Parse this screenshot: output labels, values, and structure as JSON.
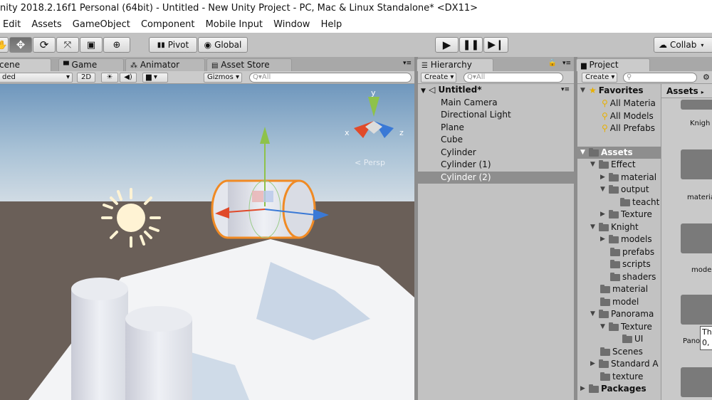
{
  "window": {
    "title": "nity 2018.2.16f1 Personal (64bit) - Untitled - New Unity Project - PC, Mac & Linux Standalone* <DX11>"
  },
  "menu": [
    "Edit",
    "Assets",
    "GameObject",
    "Component",
    "Mobile Input",
    "Window",
    "Help"
  ],
  "toolbar": {
    "pivot_label": "Pivot",
    "global_label": "Global",
    "collab_label": "Collab",
    "tools": [
      "hand-tool",
      "move-tool",
      "rotate-tool",
      "scale-tool",
      "rect-tool",
      "transform-tool"
    ]
  },
  "scene_tabs": {
    "scene": "cene",
    "game": "Game",
    "animator": "Animator",
    "asset_store": "Asset Store"
  },
  "scene_toolbar": {
    "shading": "ded",
    "mode_2d": "2D",
    "gizmos": "Gizmos",
    "search_placeholder": "Q▾All"
  },
  "gizmo": {
    "y": "y",
    "x": "x",
    "z": "z",
    "persp": "< Persp"
  },
  "hierarchy": {
    "tab": "Hierarchy",
    "create": "Create",
    "search_placeholder": "Q▾All",
    "scene_name": "Untitled*",
    "items": [
      "Main Camera",
      "Directional Light",
      "Plane",
      "Cube",
      "Cylinder",
      "Cylinder (1)",
      "Cylinder (2)"
    ],
    "selected_index": 6
  },
  "project": {
    "tab": "Project",
    "create": "Create",
    "favorites_label": "Favorites",
    "favorites": [
      "All Materia",
      "All Models",
      "All Prefabs"
    ],
    "assets_label": "Assets",
    "tree": [
      {
        "label": "Effect",
        "level": 1,
        "expanded": true
      },
      {
        "label": "material",
        "level": 2,
        "expanded": false
      },
      {
        "label": "output",
        "level": 2,
        "expanded": true
      },
      {
        "label": "teacht",
        "level": 3,
        "expanded": null
      },
      {
        "label": "Texture",
        "level": 2,
        "expanded": false
      },
      {
        "label": "Knight",
        "level": 1,
        "expanded": true
      },
      {
        "label": "models",
        "level": 2,
        "expanded": false
      },
      {
        "label": "prefabs",
        "level": 2,
        "expanded": null
      },
      {
        "label": "scripts",
        "level": 2,
        "expanded": null
      },
      {
        "label": "shaders",
        "level": 2,
        "expanded": null
      },
      {
        "label": "material",
        "level": 1,
        "expanded": null
      },
      {
        "label": "model",
        "level": 1,
        "expanded": null
      },
      {
        "label": "Panorama",
        "level": 1,
        "expanded": true
      },
      {
        "label": "Texture",
        "level": 2,
        "expanded": true
      },
      {
        "label": "UI",
        "level": 3,
        "expanded": null
      },
      {
        "label": "Scenes",
        "level": 1,
        "expanded": null
      },
      {
        "label": "Standard A",
        "level": 1,
        "expanded": false
      },
      {
        "label": "texture",
        "level": 1,
        "expanded": null
      }
    ],
    "packages_label": "Packages",
    "grid_header": "Assets",
    "grid_items": [
      "Knigh",
      "materia",
      "model",
      "Pano"
    ],
    "tooltip": [
      "Th",
      "0,"
    ]
  },
  "colors": {
    "sky_top": "#6f97bd",
    "sky_bottom": "#c9d7e2",
    "ground": "#6a5f58",
    "selection": "#f08a24"
  }
}
